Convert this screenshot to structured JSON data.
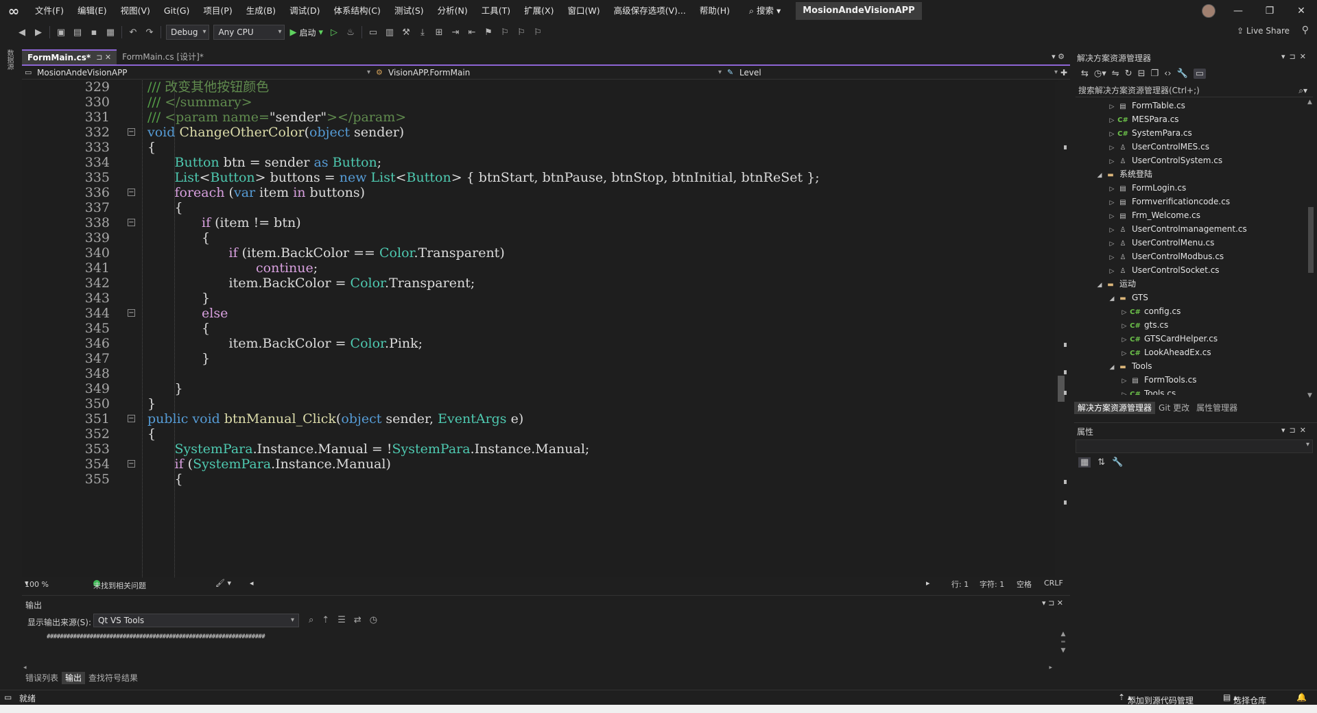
{
  "menu": [
    "文件(F)",
    "编辑(E)",
    "视图(V)",
    "Git(G)",
    "项目(P)",
    "生成(B)",
    "调试(D)",
    "体系结构(C)",
    "测试(S)",
    "分析(N)",
    "工具(T)",
    "扩展(X)",
    "窗口(W)",
    "高级保存选项(V)...",
    "帮助(H)"
  ],
  "search_label": "搜索",
  "solution_name": "MosionAndeVisionAPP",
  "toolbar": {
    "config": "Debug",
    "platform": "Any CPU",
    "run_label": "启动",
    "live_share": "Live Share"
  },
  "left_strip_label": "数据源",
  "tabs": [
    {
      "label": "FormMain.cs*",
      "active": true
    },
    {
      "label": "FormMain.cs [设计]*",
      "active": false
    }
  ],
  "navbar": {
    "project": "MosionAndeVisionAPP",
    "class": "VisionAPP.FormMain",
    "member": "Level"
  },
  "code_lines": [
    {
      "n": "329",
      "indent": 2,
      "tokens": [
        [
          "c",
          "/// "
        ],
        [
          "cx",
          "改变其他按钮颜色"
        ]
      ]
    },
    {
      "n": "330",
      "indent": 2,
      "tokens": [
        [
          "c",
          "/// "
        ],
        [
          "cx",
          "</summary>"
        ]
      ]
    },
    {
      "n": "331",
      "indent": 2,
      "tokens": [
        [
          "c",
          "/// "
        ],
        [
          "cx",
          "<param name="
        ],
        [
          "p",
          "\"sender\""
        ],
        [
          "cx",
          "></param>"
        ]
      ]
    },
    {
      "n": "332",
      "indent": 2,
      "fold": "-",
      "tokens": [
        [
          "k",
          "void"
        ],
        [
          "p",
          " "
        ],
        [
          "m",
          "ChangeOtherColor"
        ],
        [
          "p",
          "("
        ],
        [
          "k",
          "object"
        ],
        [
          "p",
          " sender)"
        ]
      ]
    },
    {
      "n": "333",
      "indent": 2,
      "tokens": [
        [
          "p",
          "{"
        ]
      ]
    },
    {
      "n": "334",
      "indent": 3,
      "tokens": [
        [
          "t",
          "Button"
        ],
        [
          "p",
          " btn = sender "
        ],
        [
          "k",
          "as"
        ],
        [
          "p",
          " "
        ],
        [
          "t",
          "Button"
        ],
        [
          "p",
          ";"
        ]
      ]
    },
    {
      "n": "335",
      "indent": 3,
      "tokens": [
        [
          "t",
          "List"
        ],
        [
          "p",
          "<"
        ],
        [
          "t",
          "Button"
        ],
        [
          "p",
          "> buttons = "
        ],
        [
          "k",
          "new"
        ],
        [
          "p",
          " "
        ],
        [
          "t",
          "List"
        ],
        [
          "p",
          "<"
        ],
        [
          "t",
          "Button"
        ],
        [
          "p",
          "> { btnStart, btnPause, btnStop, btnInitial, btnReSet };"
        ]
      ]
    },
    {
      "n": "336",
      "indent": 3,
      "fold": "-",
      "tokens": [
        [
          "kc",
          "foreach"
        ],
        [
          "p",
          " ("
        ],
        [
          "k",
          "var"
        ],
        [
          "p",
          " item "
        ],
        [
          "kc",
          "in"
        ],
        [
          "p",
          " buttons)"
        ]
      ]
    },
    {
      "n": "337",
      "indent": 3,
      "tokens": [
        [
          "p",
          "{"
        ]
      ]
    },
    {
      "n": "338",
      "indent": 4,
      "fold": "-",
      "tokens": [
        [
          "kc",
          "if"
        ],
        [
          "p",
          " (item != btn)"
        ]
      ]
    },
    {
      "n": "339",
      "indent": 4,
      "tokens": [
        [
          "p",
          "{"
        ]
      ]
    },
    {
      "n": "340",
      "indent": 5,
      "tokens": [
        [
          "kc",
          "if"
        ],
        [
          "p",
          " (item.BackColor == "
        ],
        [
          "t",
          "Color"
        ],
        [
          "p",
          ".Transparent)"
        ]
      ]
    },
    {
      "n": "341",
      "indent": 6,
      "tokens": [
        [
          "kc",
          "continue"
        ],
        [
          "p",
          ";"
        ]
      ]
    },
    {
      "n": "342",
      "indent": 5,
      "tokens": [
        [
          "p",
          "item.BackColor = "
        ],
        [
          "t",
          "Color"
        ],
        [
          "p",
          ".Transparent;"
        ]
      ]
    },
    {
      "n": "343",
      "indent": 4,
      "tokens": [
        [
          "p",
          "}"
        ]
      ]
    },
    {
      "n": "344",
      "indent": 4,
      "fold": "-",
      "tokens": [
        [
          "kc",
          "else"
        ]
      ]
    },
    {
      "n": "345",
      "indent": 4,
      "tokens": [
        [
          "p",
          "{"
        ]
      ]
    },
    {
      "n": "346",
      "indent": 5,
      "tokens": [
        [
          "p",
          "item.BackColor = "
        ],
        [
          "t",
          "Color"
        ],
        [
          "p",
          ".Pink;"
        ]
      ]
    },
    {
      "n": "347",
      "indent": 4,
      "tokens": [
        [
          "p",
          "}"
        ]
      ]
    },
    {
      "n": "348",
      "indent": 0,
      "tokens": []
    },
    {
      "n": "349",
      "indent": 3,
      "tokens": [
        [
          "p",
          "}"
        ]
      ]
    },
    {
      "n": "350",
      "indent": 2,
      "tokens": [
        [
          "p",
          "}"
        ]
      ]
    },
    {
      "n": "351",
      "indent": 2,
      "fold": "-",
      "tokens": [
        [
          "k",
          "public"
        ],
        [
          "p",
          " "
        ],
        [
          "k",
          "void"
        ],
        [
          "p",
          " "
        ],
        [
          "m",
          "btnManual_Click"
        ],
        [
          "p",
          "("
        ],
        [
          "k",
          "object"
        ],
        [
          "p",
          " sender, "
        ],
        [
          "t",
          "EventArgs"
        ],
        [
          "p",
          " e)"
        ]
      ]
    },
    {
      "n": "352",
      "indent": 2,
      "tokens": [
        [
          "p",
          "{"
        ]
      ]
    },
    {
      "n": "353",
      "indent": 3,
      "tokens": [
        [
          "t",
          "SystemPara"
        ],
        [
          "p",
          ".Instance.Manual = !"
        ],
        [
          "t",
          "SystemPara"
        ],
        [
          "p",
          ".Instance.Manual;"
        ]
      ]
    },
    {
      "n": "354",
      "indent": 3,
      "fold": "-",
      "tokens": [
        [
          "kc",
          "if"
        ],
        [
          "p",
          " ("
        ],
        [
          "t",
          "SystemPara"
        ],
        [
          "p",
          ".Instance.Manual)"
        ]
      ]
    },
    {
      "n": "355",
      "indent": 3,
      "tokens": [
        [
          "p",
          "{"
        ]
      ]
    }
  ],
  "editor_status": {
    "zoom": "100 %",
    "issues": "未找到相关问题",
    "line": "行: 1",
    "char": "字符: 1",
    "whitespace": "空格",
    "eol": "CRLF"
  },
  "output": {
    "title": "输出",
    "source_label": "显示输出来源(S):",
    "source_value": "Qt VS Tools",
    "text": "##################################################################"
  },
  "bottom_tabs": [
    {
      "label": "错误列表",
      "active": false
    },
    {
      "label": "输出",
      "active": true
    },
    {
      "label": "查找符号结果",
      "active": false
    }
  ],
  "solution_explorer": {
    "title": "解决方案资源管理器",
    "search_placeholder": "搜索解决方案资源管理器(Ctrl+;)",
    "items": [
      {
        "label": "FormTable.cs",
        "level": 2,
        "icon": "form",
        "arrow": "▷"
      },
      {
        "label": "MESPara.cs",
        "level": 2,
        "icon": "cs",
        "arrow": "▷"
      },
      {
        "label": "SystemPara.cs",
        "level": 2,
        "icon": "cs",
        "arrow": "▷"
      },
      {
        "label": "UserControlMES.cs",
        "level": 2,
        "icon": "user",
        "arrow": "▷"
      },
      {
        "label": "UserControlSystem.cs",
        "level": 2,
        "icon": "user",
        "arrow": "▷"
      },
      {
        "label": "系统登陆",
        "level": 1,
        "icon": "folder",
        "arrow": "◢"
      },
      {
        "label": "FormLogin.cs",
        "level": 2,
        "icon": "form",
        "arrow": "▷"
      },
      {
        "label": "Formverificationcode.cs",
        "level": 2,
        "icon": "form",
        "arrow": "▷"
      },
      {
        "label": "Frm_Welcome.cs",
        "level": 2,
        "icon": "form",
        "arrow": "▷"
      },
      {
        "label": "UserControlmanagement.cs",
        "level": 2,
        "icon": "user",
        "arrow": "▷"
      },
      {
        "label": "UserControlMenu.cs",
        "level": 2,
        "icon": "user",
        "arrow": "▷"
      },
      {
        "label": "UserControlModbus.cs",
        "level": 2,
        "icon": "user",
        "arrow": "▷"
      },
      {
        "label": "UserControlSocket.cs",
        "level": 2,
        "icon": "user",
        "arrow": "▷"
      },
      {
        "label": "运动",
        "level": 1,
        "icon": "folder",
        "arrow": "◢"
      },
      {
        "label": "GTS",
        "level": 2,
        "icon": "folder",
        "arrow": "◢"
      },
      {
        "label": "config.cs",
        "level": 3,
        "icon": "cs",
        "arrow": "▷"
      },
      {
        "label": "gts.cs",
        "level": 3,
        "icon": "cs",
        "arrow": "▷"
      },
      {
        "label": "GTSCardHelper.cs",
        "level": 3,
        "icon": "cs",
        "arrow": "▷"
      },
      {
        "label": "LookAheadEx.cs",
        "level": 3,
        "icon": "cs",
        "arrow": "▷"
      },
      {
        "label": "Tools",
        "level": 2,
        "icon": "folder",
        "arrow": "◢"
      },
      {
        "label": "FormTools.cs",
        "level": 3,
        "icon": "form",
        "arrow": "▷"
      },
      {
        "label": "Tools.cs",
        "level": 3,
        "icon": "cs",
        "arrow": "▷"
      }
    ],
    "tabs": [
      {
        "label": "解决方案资源管理器",
        "active": true
      },
      {
        "label": "Git 更改",
        "active": false
      },
      {
        "label": "属性管理器",
        "active": false
      }
    ]
  },
  "properties": {
    "title": "属性"
  },
  "statusbar": {
    "ready": "就绪",
    "add_source": "添加到源代码管理",
    "select_repo": "选择仓库"
  }
}
